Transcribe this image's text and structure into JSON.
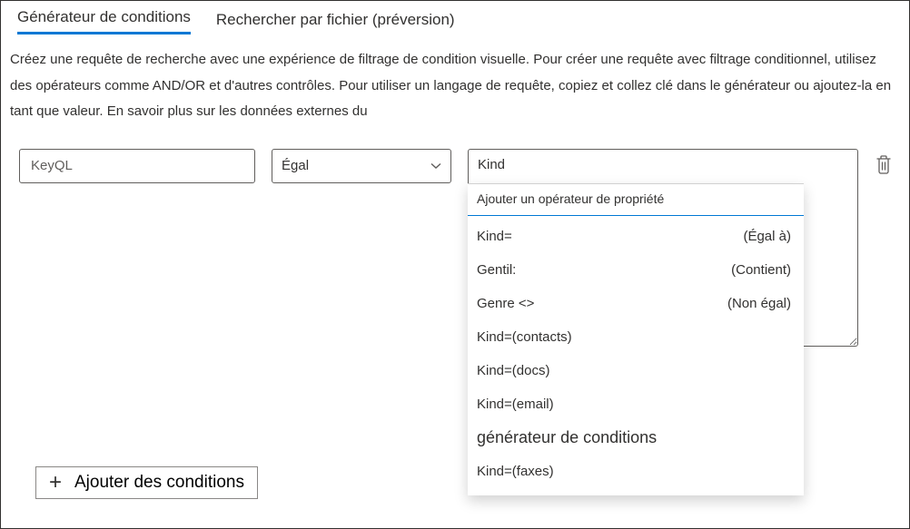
{
  "tabs": {
    "builder": "Générateur de conditions",
    "search_by_file": "Rechercher par fichier (préversion)"
  },
  "description": "Créez une requête de recherche avec une expérience de filtrage de condition visuelle. Pour créer une requête avec filtrage conditionnel, utilisez des opérateurs comme AND/OR et d'autres contrôles. Pour utiliser un langage de requête, copiez et collez clé dans le générateur ou ajoutez-la en tant que valeur. En savoir plus sur les données externes du",
  "condition": {
    "field_value": "KeyQL",
    "operator_label": "Égal",
    "value_text": "Kind"
  },
  "dropdown": {
    "header": "Ajouter un opérateur de propriété",
    "items": [
      {
        "label": "Kind=",
        "hint": "(Égal à)"
      },
      {
        "label": "Gentil:",
        "hint": "(Contient)"
      },
      {
        "label": "Genre <>",
        "hint": "(Non égal)"
      },
      {
        "label": "Kind=(contacts)",
        "hint": ""
      },
      {
        "label": "Kind=(docs)",
        "hint": ""
      },
      {
        "label": "Kind=(email)",
        "hint": ""
      }
    ],
    "section_title": "générateur de conditions",
    "after_items": [
      {
        "label": "Kind=(faxes)",
        "hint": ""
      }
    ]
  },
  "add_conditions_label": "Ajouter des conditions"
}
